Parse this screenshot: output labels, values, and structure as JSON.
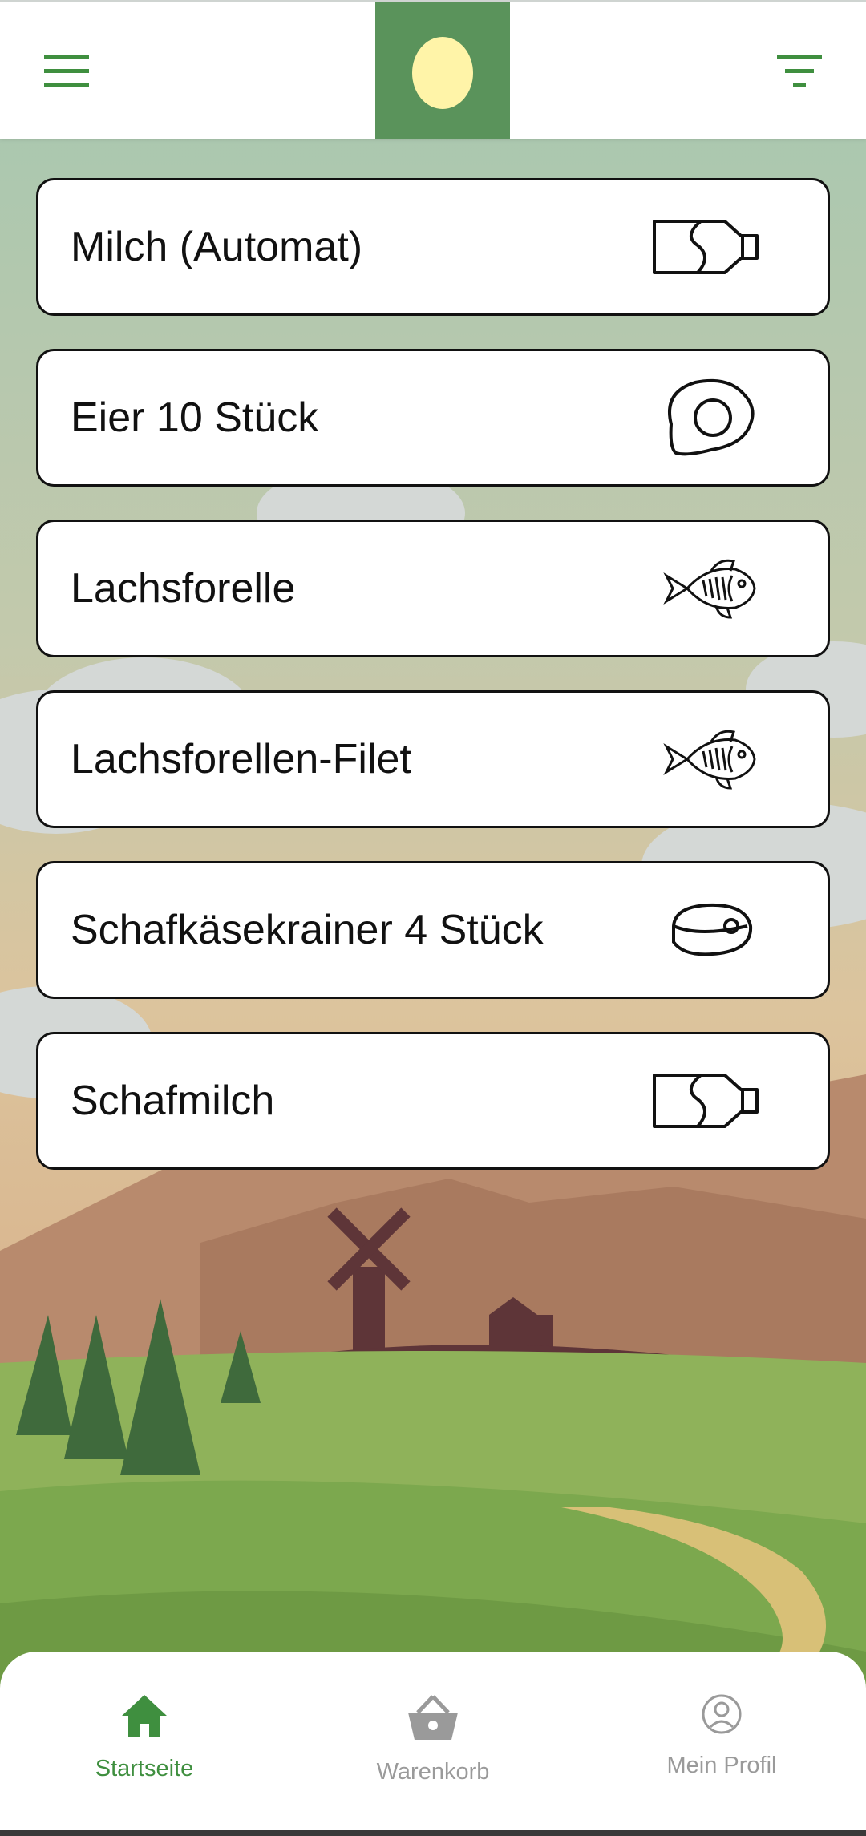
{
  "header": {
    "menu_icon": "hamburger-menu-icon",
    "logo_icon": "egg-icon",
    "filter_icon": "filter-icon",
    "accent": "#5a935b",
    "egg_color": "#fff4a8"
  },
  "products": [
    {
      "label": "Milch (Automat)",
      "icon": "milk-bottle-icon"
    },
    {
      "label": "Eier 10 Stück",
      "icon": "fried-egg-icon"
    },
    {
      "label": "Lachsforelle",
      "icon": "fish-icon"
    },
    {
      "label": "Lachsforellen-Filet",
      "icon": "fish-icon"
    },
    {
      "label": "Schafkäsekrainer 4 Stück",
      "icon": "meat-icon"
    },
    {
      "label": "Schafmilch",
      "icon": "milk-bottle-icon"
    }
  ],
  "bottom_nav": {
    "home": {
      "label": "Startseite",
      "icon": "home-icon",
      "active": true
    },
    "cart": {
      "label": "Warenkorb",
      "icon": "basket-icon",
      "active": false
    },
    "profile": {
      "label": "Mein Profil",
      "icon": "profile-icon",
      "active": false
    },
    "active_color": "#3f8f3f",
    "inactive_color": "#9a9a9a"
  }
}
